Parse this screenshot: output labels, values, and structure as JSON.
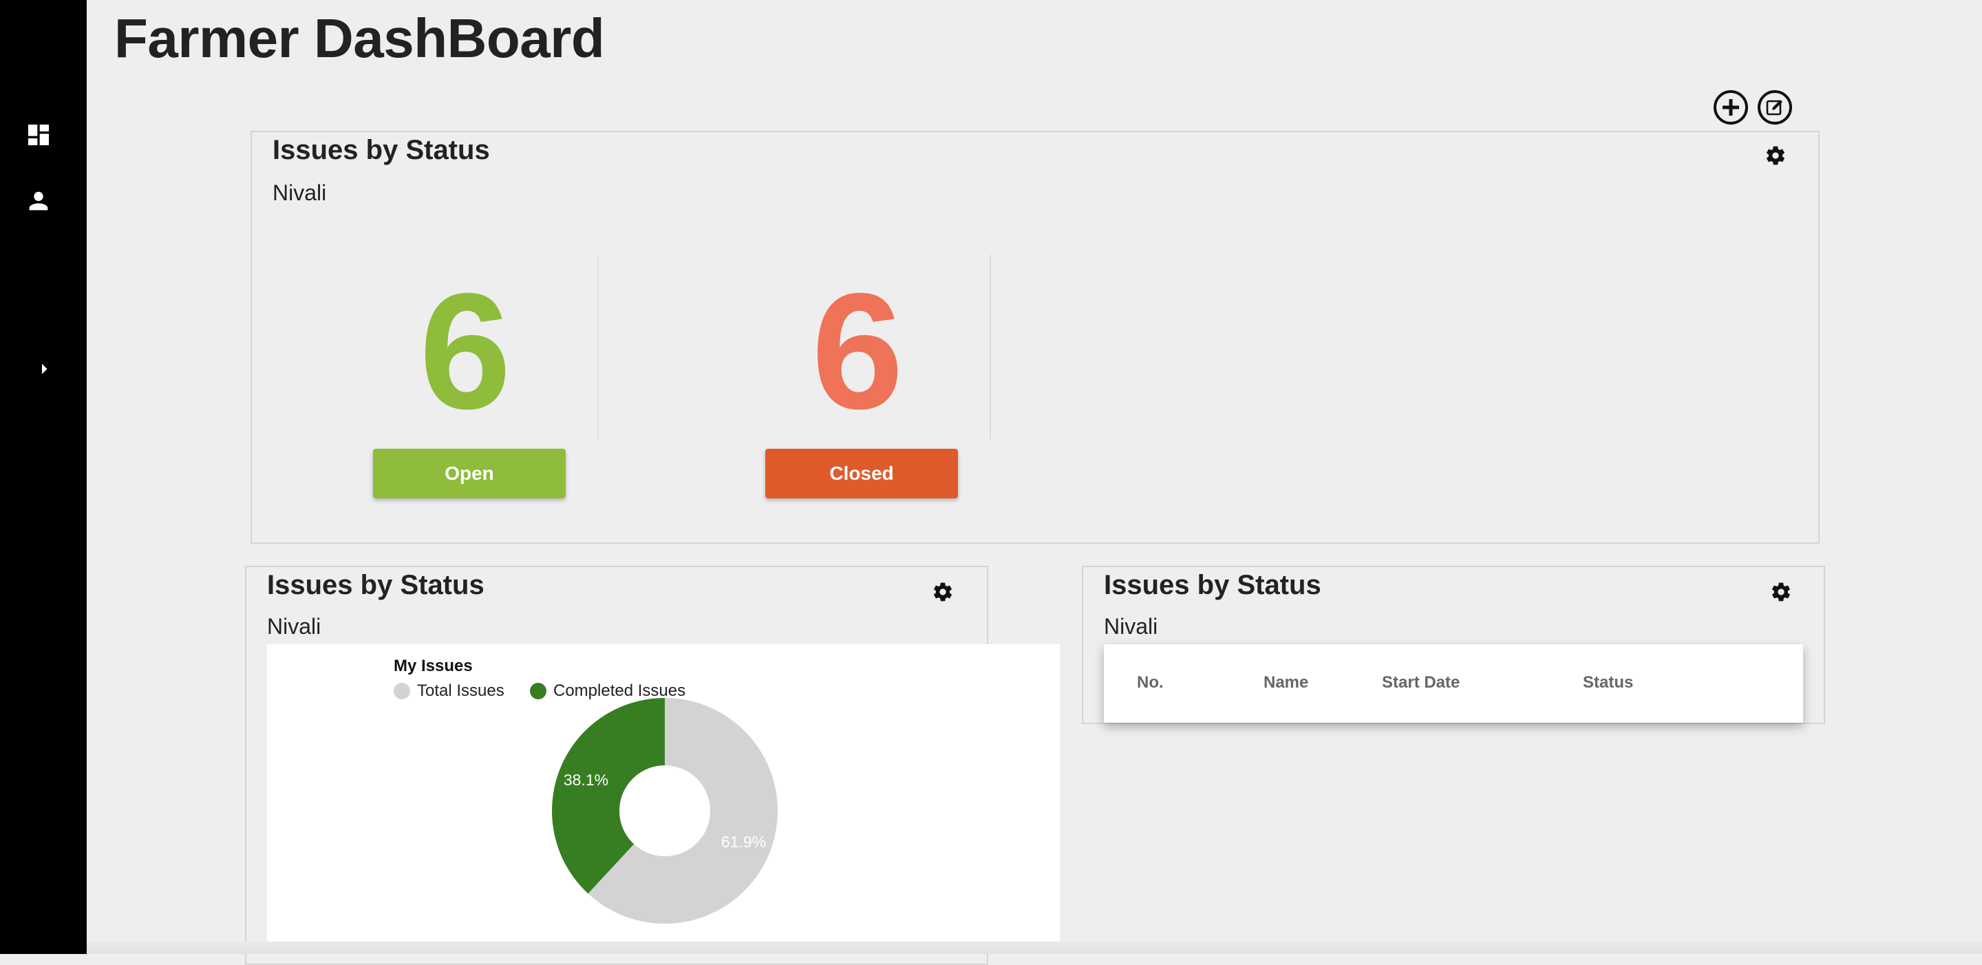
{
  "page": {
    "title": "Farmer DashBoard"
  },
  "sidebar": {
    "icons": [
      "dashboard-icon",
      "person-icon",
      "chevron-right-icon"
    ]
  },
  "toolbar": {
    "icons": [
      "add-circle-icon",
      "edit-icon"
    ]
  },
  "colors": {
    "open": "#8fbc3a",
    "closed": "#e05a2b",
    "closed_number": "#ef7359",
    "total_slice": "#d3d3d3",
    "completed_slice": "#377d22"
  },
  "status_card": {
    "title": "Issues by Status",
    "subtitle": "Nivali",
    "open": {
      "count": "6",
      "label": "Open"
    },
    "closed": {
      "count": "6",
      "label": "Closed"
    }
  },
  "chart_card": {
    "title": "Issues by Status",
    "subtitle": "Nivali",
    "chart_data": {
      "type": "pie",
      "title": "My Issues",
      "categories": [
        "Total Issues",
        "Completed Issues"
      ],
      "values": [
        61.9,
        38.1
      ],
      "labels": [
        "61.9%",
        "38.1%"
      ],
      "colors": [
        "#d3d3d3",
        "#377d22"
      ],
      "legend": "top-left",
      "donut": true
    }
  },
  "table_card": {
    "title": "Issues by Status",
    "subtitle": "Nivali",
    "columns": [
      "No.",
      "Name",
      "Start Date",
      "Status"
    ],
    "rows": []
  }
}
